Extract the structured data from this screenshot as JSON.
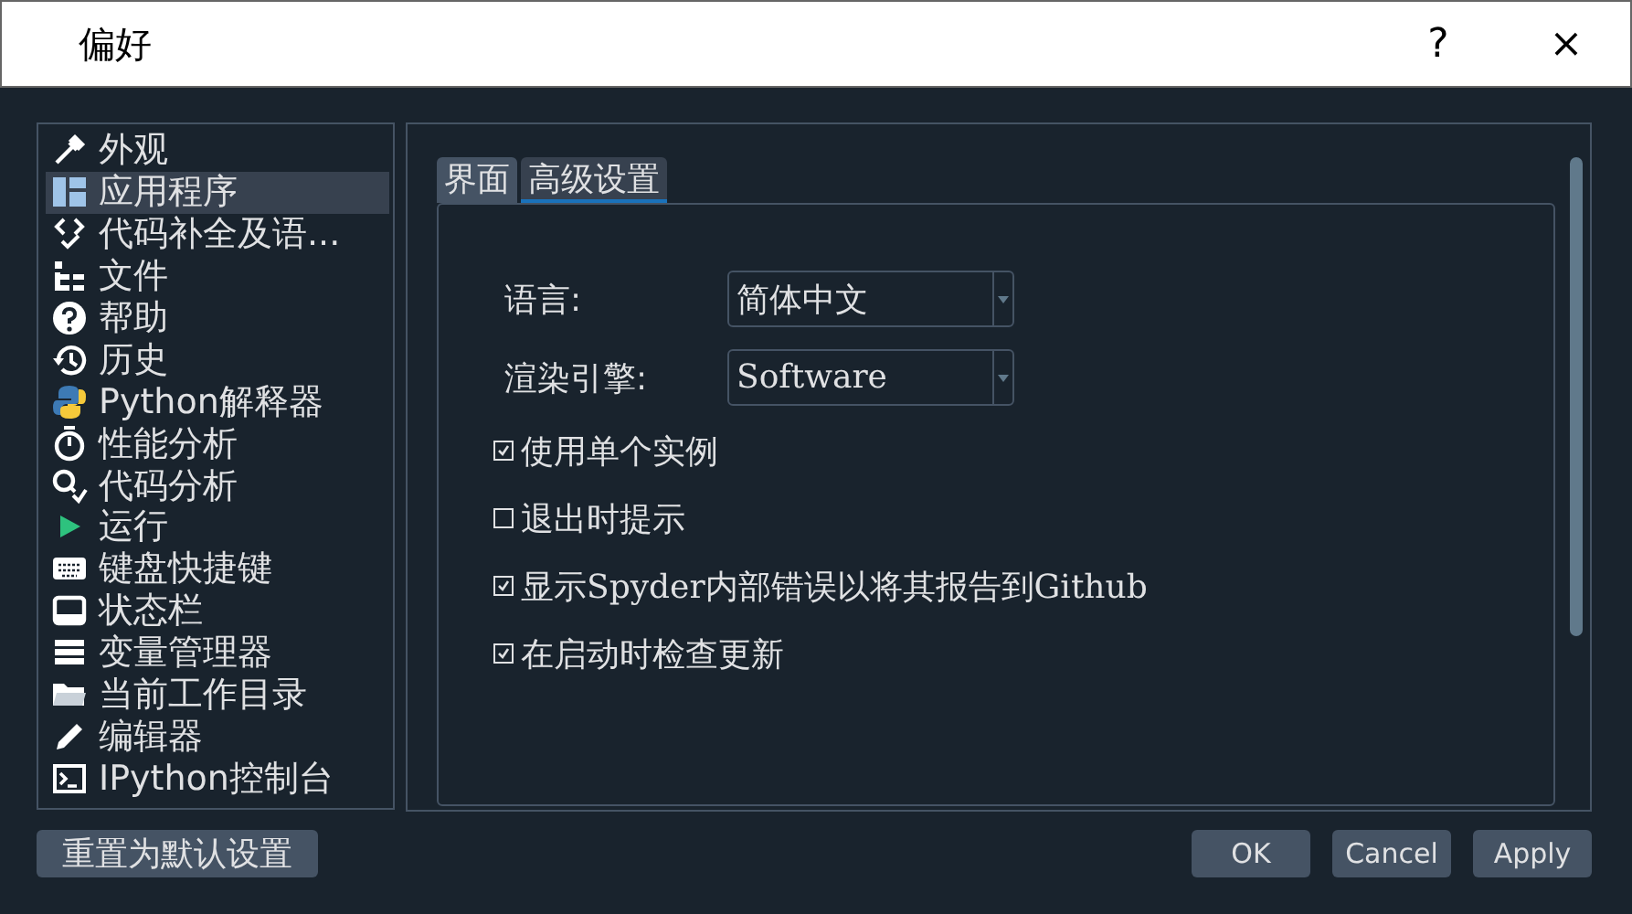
{
  "window": {
    "title": "偏好",
    "help": "?",
    "close": "×"
  },
  "sidebar": {
    "items": [
      {
        "label": "外观",
        "selected": false
      },
      {
        "label": "应用程序",
        "selected": true
      },
      {
        "label": "代码补全及语...",
        "selected": false
      },
      {
        "label": "文件",
        "selected": false
      },
      {
        "label": "帮助",
        "selected": false
      },
      {
        "label": "历史",
        "selected": false
      },
      {
        "label": "Python解释器",
        "selected": false
      },
      {
        "label": "性能分析",
        "selected": false
      },
      {
        "label": "代码分析",
        "selected": false
      },
      {
        "label": "运行",
        "selected": false
      },
      {
        "label": "键盘快捷键",
        "selected": false
      },
      {
        "label": "状态栏",
        "selected": false
      },
      {
        "label": "变量管理器",
        "selected": false
      },
      {
        "label": "当前工作目录",
        "selected": false
      },
      {
        "label": "编辑器",
        "selected": false
      },
      {
        "label": "IPython控制台",
        "selected": false
      }
    ]
  },
  "tabs": [
    {
      "label": "界面",
      "selected": false
    },
    {
      "label": "高级设置",
      "selected": true
    }
  ],
  "settings": [
    {
      "kind": "combo",
      "label": "语言:",
      "value": "简体中文"
    },
    {
      "kind": "combo",
      "label": "渲染引擎:",
      "value": "Software"
    },
    {
      "kind": "check",
      "label": "使用单个实例",
      "checked": true
    },
    {
      "kind": "check",
      "label": "退出时提示",
      "checked": false
    },
    {
      "kind": "check",
      "label": "显示Spyder内部错误以将其报告到Github",
      "checked": true
    },
    {
      "kind": "check",
      "label": "在启动时检查更新",
      "checked": true
    }
  ],
  "buttons": {
    "reset": "重置为默认设置",
    "actions": [
      "OK",
      "Cancel",
      "Apply"
    ]
  }
}
